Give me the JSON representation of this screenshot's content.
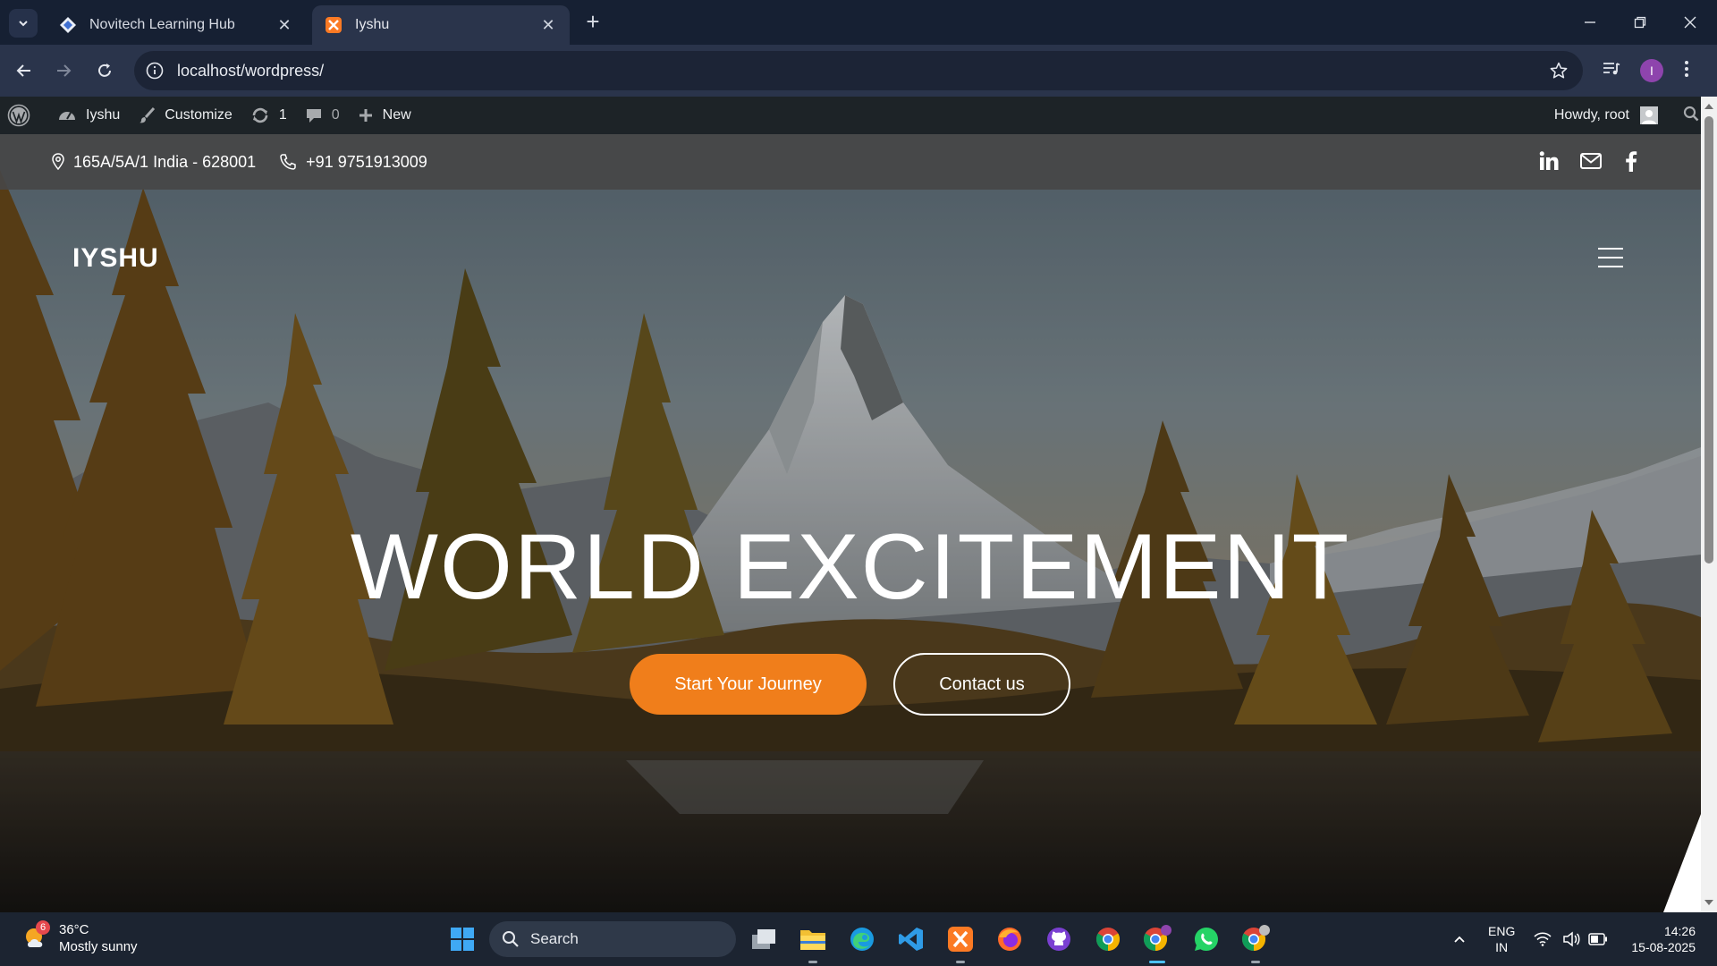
{
  "browser": {
    "tabs": [
      {
        "title": "Novitech Learning Hub",
        "favicon": "novitech-icon",
        "active": false
      },
      {
        "title": "Iyshu",
        "favicon": "xampp-icon",
        "active": true
      }
    ],
    "url": "localhost/wordpress/",
    "profile_initial": "I"
  },
  "adminbar": {
    "site_name": "Iyshu",
    "customize": "Customize",
    "updates_count": "1",
    "comments_count": "0",
    "new_label": "New",
    "howdy": "Howdy, root"
  },
  "site": {
    "address": "165A/5A/1 India - 628001",
    "phone": "+91 9751913009",
    "social": [
      "linkedin-icon",
      "mail-icon",
      "facebook-icon"
    ],
    "brand": "IYSHU",
    "headline": "WORLD EXCITEMENT",
    "cta_primary": "Start Your Journey",
    "cta_secondary": "Contact us",
    "accent_color": "#f07e1b"
  },
  "taskbar": {
    "weather_temp": "36°C",
    "weather_desc": "Mostly sunny",
    "weather_badge": "6",
    "search_placeholder": "Search",
    "lang_top": "ENG",
    "lang_bottom": "IN",
    "time": "14:26",
    "date": "15-08-2025",
    "pinned": [
      "task-view-icon",
      "file-explorer-icon",
      "edge-icon",
      "vscode-icon",
      "xampp-icon",
      "firefox-icon",
      "github-desktop-icon",
      "chrome-icon",
      "chrome-profile-icon",
      "whatsapp-icon",
      "chrome-alt-icon"
    ]
  }
}
